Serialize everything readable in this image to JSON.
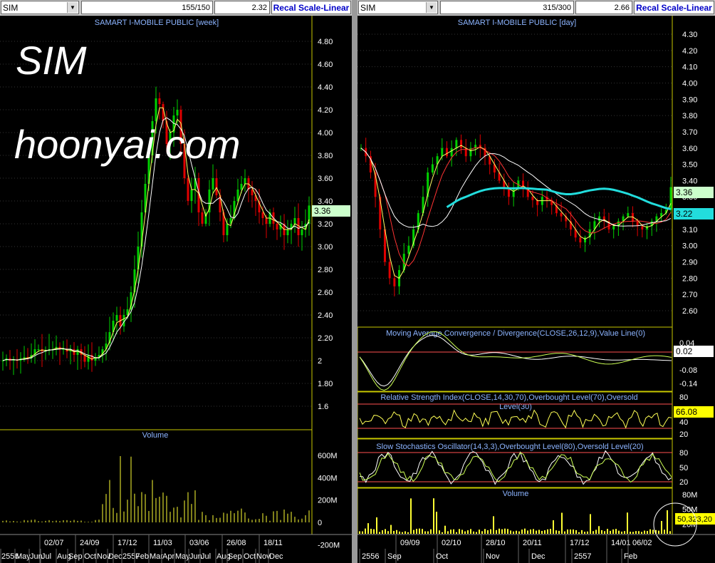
{
  "left": {
    "symbol": "SIM",
    "count": "155/150",
    "price": "2.32",
    "recal_label": "Recal Scale-Linear",
    "title": "SAMART I-MOBILE PUBLIC [week]",
    "price_ticks": [
      "4.80",
      "4.60",
      "4.40",
      "4.20",
      "4.00",
      "3.80",
      "3.60",
      "3.40",
      "3.20",
      "3.00",
      "2.80",
      "2.60",
      "2.40",
      "2.20",
      "2",
      "1.80",
      "1.6"
    ],
    "last_price_label": "3.36",
    "volume_title": "Volume",
    "volume_ticks": [
      "600M",
      "400M",
      "200M",
      "0",
      "-200M"
    ],
    "date_labels": [
      "02/07",
      "24/09",
      "17/12",
      "11/03",
      "03/06",
      "26/08",
      "18/11"
    ],
    "month_labels": [
      "2556",
      "May",
      "Jun",
      "Jul",
      "Aug",
      "Sep",
      "Oct",
      "Nov",
      "Dec",
      "2557",
      "Feb",
      "Mar",
      "Apr",
      "May",
      "Jun",
      "Jul",
      "Aug",
      "Sep",
      "Oct",
      "Nov",
      "Dec"
    ]
  },
  "right": {
    "symbol": "SIM",
    "count": "315/300",
    "price": "2.66",
    "recal_label": "Recal Scale-Linear",
    "title": "SAMART I-MOBILE PUBLIC [day]",
    "price_ticks": [
      "4.30",
      "4.20",
      "4.10",
      "4.00",
      "3.90",
      "3.80",
      "3.70",
      "3.60",
      "3.50",
      "3.40",
      "3.30",
      "3.20",
      "3.10",
      "3.00",
      "2.90",
      "2.80",
      "2.70",
      "2.60"
    ],
    "last_price_label": "3.36",
    "ma_label": "3.22",
    "macd_title": "Moving Average Convergence / Divergence(CLOSE,26,12,9),Value Line(0)",
    "macd_ticks": [
      "0.04",
      "-0.08",
      "-0.14"
    ],
    "macd_value": "0.02",
    "rsi_title": "Relative Strength Index(CLOSE,14,30,70),Overbought Level(70),Oversold Level(30)",
    "rsi_ticks": [
      "80",
      "60",
      "40",
      "20"
    ],
    "rsi_value": "66.08",
    "stoch_title": "Slow Stochastics Oscillator(14,3,3),Overbought Level(80),Oversold Level(20)",
    "stoch_ticks": [
      "80",
      "50",
      "20"
    ],
    "volume_title": "Volume",
    "volume_ticks": [
      "80M",
      "50M",
      "20M"
    ],
    "volume_value": "50,323,20",
    "date_labels": [
      "09/09",
      "02/10",
      "28/10",
      "20/11",
      "17/12",
      "14/01",
      "06/02"
    ],
    "month_labels": [
      "2556",
      "Sep",
      "Oct",
      "Nov",
      "Dec",
      "2557",
      "Feb"
    ]
  },
  "watermark": {
    "symbol": "SIM",
    "site": "hoonyai.com"
  },
  "colors": {
    "up": "#00d000",
    "down": "#e00000",
    "ma_fast": "#ffff66",
    "ma_slow": "#ffffff",
    "ma_mid": "#ff3333",
    "ma_long": "#22dddd",
    "title": "#8cb4ff",
    "axis": "#ffffff",
    "volume": "#ffff33",
    "price_label_bg": "#ccffcc",
    "ma_label_bg": "#22dddd",
    "value_label_bg": "#ffff00"
  },
  "chart_data": [
    {
      "type": "candlestick",
      "title": "SAMART I-MOBILE PUBLIC [week]",
      "ylim": [
        1.5,
        4.9
      ],
      "series": [
        {
          "name": "price",
          "close": [
            2.0,
            2.02,
            2.0,
            2.01,
            2.0,
            2.02,
            2.03,
            2.02,
            2.05,
            2.1,
            2.1,
            2.08,
            2.09,
            2.1,
            2.1,
            2.12,
            2.1,
            2.1,
            2.08,
            2.1,
            2.05,
            2.1,
            2.05,
            1.99,
            2.05,
            2.0,
            2.03,
            2.05,
            2.1,
            2.15,
            2.25,
            2.35,
            2.4,
            2.3,
            2.4,
            2.45,
            2.6,
            2.8,
            3.0,
            3.3,
            3.55,
            3.8,
            4.1,
            4.3,
            4.25,
            4.1,
            3.9,
            4.0,
            4.15,
            4.2,
            3.9,
            3.6,
            3.4,
            3.5,
            3.6,
            3.3,
            3.2,
            3.3,
            3.5,
            3.6,
            3.45,
            3.3,
            3.1,
            3.2,
            3.25,
            3.4,
            3.5,
            3.55,
            3.6,
            3.5,
            3.45,
            3.4,
            3.3,
            3.25,
            3.2,
            3.3,
            3.2,
            3.15,
            3.2,
            3.1,
            3.15,
            3.2,
            3.25,
            3.1,
            3.15,
            3.2,
            3.36
          ]
        }
      ]
    },
    {
      "type": "candlestick",
      "title": "SAMART I-MOBILE PUBLIC [day]",
      "ylim": [
        2.55,
        4.35
      ],
      "series": [
        {
          "name": "price",
          "close": [
            3.6,
            3.55,
            3.45,
            3.3,
            3.1,
            2.9,
            2.8,
            2.75,
            2.85,
            2.95,
            3.0,
            3.1,
            3.2,
            3.3,
            3.45,
            3.5,
            3.55,
            3.6,
            3.55,
            3.6,
            3.65,
            3.6,
            3.55,
            3.6,
            3.62,
            3.6,
            3.55,
            3.5,
            3.45,
            3.4,
            3.35,
            3.3,
            3.35,
            3.4,
            3.35,
            3.3,
            3.28,
            3.25,
            3.3,
            3.28,
            3.25,
            3.2,
            3.18,
            3.15,
            3.1,
            3.05,
            3.02,
            3.05,
            3.1,
            3.15,
            3.18,
            3.15,
            3.1,
            3.12,
            3.15,
            3.18,
            3.2,
            3.15,
            3.12,
            3.1,
            3.12,
            3.15,
            3.18,
            3.2,
            3.22,
            3.36
          ]
        }
      ]
    }
  ]
}
